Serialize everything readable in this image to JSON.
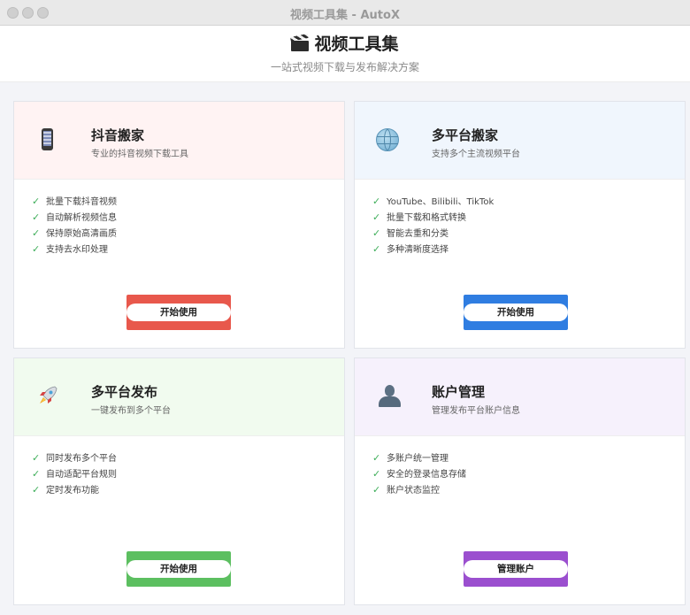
{
  "window": {
    "title": "视频工具集 - AutoX"
  },
  "header": {
    "title": "视频工具集",
    "subtitle": "一站式视频下载与发布解决方案"
  },
  "cards": [
    {
      "title": "抖音搬家",
      "description": "专业的抖音视频下载工具",
      "icon": "mobile-phone-icon",
      "header_bg": "#fff3f3",
      "accent": "#e8584c",
      "features": [
        "批量下载抖音视频",
        "自动解析视频信息",
        "保持原始高清画质",
        "支持去水印处理"
      ],
      "button_label": "开始使用"
    },
    {
      "title": "多平台搬家",
      "description": "支持多个主流视频平台",
      "icon": "globe-icon",
      "header_bg": "#f0f6fd",
      "accent": "#2f7de1",
      "features": [
        "YouTube、Bilibili、TikTok",
        "批量下载和格式转换",
        "智能去重和分类",
        "多种清晰度选择"
      ],
      "button_label": "开始使用"
    },
    {
      "title": "多平台发布",
      "description": "一键发布到多个平台",
      "icon": "rocket-icon",
      "header_bg": "#f1fbef",
      "accent": "#5cbf60",
      "features": [
        "同时发布多个平台",
        "自动适配平台规则",
        "定时发布功能"
      ],
      "button_label": "开始使用"
    },
    {
      "title": "账户管理",
      "description": "管理发布平台账户信息",
      "icon": "user-silhouette-icon",
      "header_bg": "#f6f1fc",
      "accent": "#9b4fcf",
      "features": [
        "多账户统一管理",
        "安全的登录信息存储",
        "账户状态监控"
      ],
      "button_label": "管理账户"
    }
  ]
}
